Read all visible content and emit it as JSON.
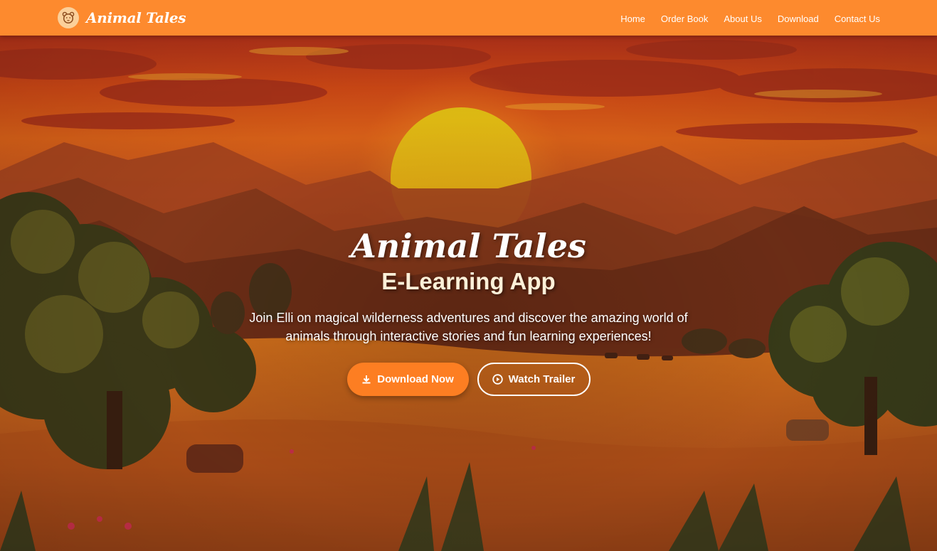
{
  "brand": {
    "name": "Animal Tales",
    "icon": "bear-face-icon"
  },
  "nav": {
    "items": [
      {
        "label": "Home"
      },
      {
        "label": "Order Book"
      },
      {
        "label": "About Us"
      },
      {
        "label": "Download"
      },
      {
        "label": "Contact Us"
      }
    ]
  },
  "hero": {
    "title": "Animal Tales",
    "subtitle": "E-Learning App",
    "description": "Join Elli on magical wilderness adventures and discover the amazing world of animals through interactive stories and fun learning experiences!",
    "primary_button": {
      "label": "Download Now",
      "icon": "download-icon"
    },
    "secondary_button": {
      "label": "Watch Trailer",
      "icon": "play-circle-icon"
    }
  },
  "colors": {
    "navbar": "#fd8a2e",
    "accent": "#fd7e22",
    "sun": "#f2c21a"
  }
}
